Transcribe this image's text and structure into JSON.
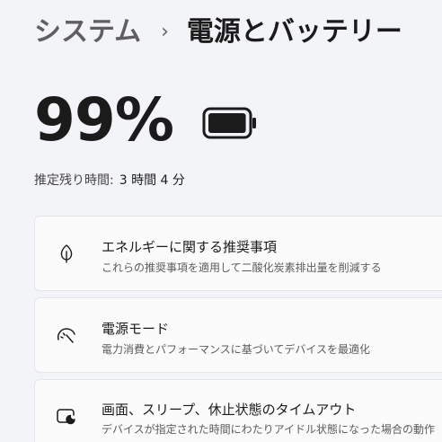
{
  "breadcrumb": {
    "parent": "システム",
    "separator": "›",
    "current": "電源とバッテリー"
  },
  "battery": {
    "percent_label": "99%",
    "level": 0.99,
    "icon": "battery-full-icon"
  },
  "estimate": {
    "label": "推定残り時間:",
    "value": "3 時間 4 分"
  },
  "cards": [
    {
      "icon": "leaf-icon",
      "title": "エネルギーに関する推奨事項",
      "description": "これらの推奨事項を適用して二酸化炭素排出量を削減する"
    },
    {
      "icon": "power-mode-gauge-icon",
      "title": "電源モード",
      "description": "電力消費とパフォーマンスに基づいてデバイスを最適化"
    },
    {
      "icon": "screen-sleep-icon",
      "title": "画面、スリープ、休止状態のタイムアウト",
      "description": "デバイスが指定された時間にわたりアイドル状態になった場合の動作"
    }
  ],
  "colors": {
    "background": "#f3f4f7",
    "card": "#fbfbfc",
    "text_primary": "#1b1b1b",
    "text_secondary": "#5c5c5c"
  }
}
